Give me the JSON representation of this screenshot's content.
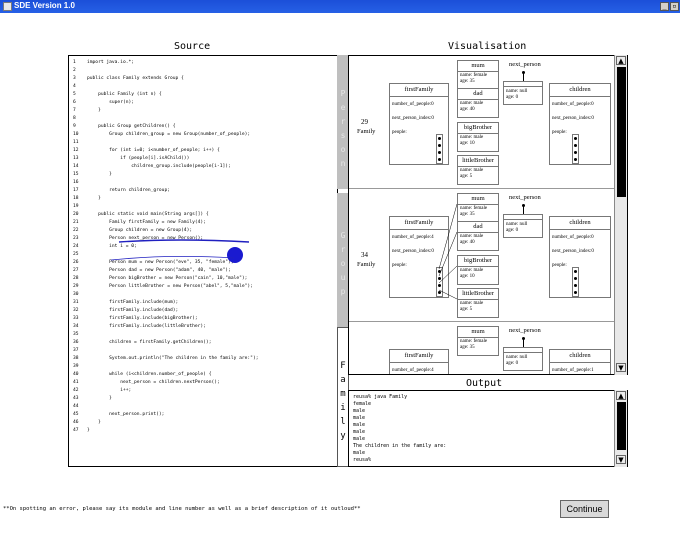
{
  "window": {
    "title": "SDE Version 1.0"
  },
  "source": {
    "header": "Source",
    "lines": [
      "import java.io.*;",
      "",
      "public class Family extends Group {",
      "",
      "    public Family (int n) {",
      "        super(n);",
      "    }",
      "",
      "    public Group getChildren() {",
      "        Group children_group = new Group(number_of_people);",
      "",
      "        for (int i=0; i<number_of_people; i++) {",
      "            if (people[i].isAChild())",
      "                children_group.include(people[i-1]);",
      "        }",
      "",
      "        return children_group;",
      "    }",
      "",
      "    public static void main(String args[]) {",
      "        Family firstFamily = new Family(4);",
      "        Group children = new Group(4);",
      "        Person next_person = new Person();",
      "        int i = 0;",
      "",
      "        Person mum = new Person(\"eve\", 35, \"female\");",
      "        Person dad = new Person(\"adam\", 40, \"male\");",
      "        Person bigBrother = new Person(\"cain\", 10,\"male\");",
      "        Person littleBrother = new Person(\"abel\", 5,\"male\");",
      "",
      "        firstFamily.include(mum);",
      "        firstFamily.include(dad);",
      "        firstFamily.include(bigBrother);",
      "        firstFamily.include(littleBrother);",
      "",
      "        children = firstFamily.getChildren();",
      "",
      "        System.out.println(\"The children in the family are:\");",
      "",
      "        while (i<children.number_of_people) {",
      "            next_person = children.nextPerson();",
      "            i++;",
      "        }",
      "",
      "        next_person.print();",
      "    }",
      "}"
    ]
  },
  "side_tabs": {
    "person": [
      "P",
      "e",
      "r",
      "s",
      "o",
      "n"
    ],
    "group": [
      "G",
      "r",
      "o",
      "u",
      "p"
    ],
    "family": [
      "F",
      "a",
      "m",
      "i",
      "l",
      "y"
    ]
  },
  "visualisation": {
    "header": "Visualisation",
    "frames": [
      {
        "count": "29",
        "label": "Family",
        "box_title": "firstFamily",
        "nop": "number_of_people:0",
        "npi": "next_person_index:0",
        "people": "people:",
        "children_title": "children",
        "c_nop": "number_of_people:0",
        "c_npi": "next_person_index:0",
        "c_people": "people:",
        "np_title": "next_person",
        "np_name": "name: null",
        "np_age": "age: 0",
        "mum": {
          "title": "mum",
          "name": "name: female",
          "age": "age: 35"
        },
        "dad": {
          "title": "dad",
          "name": "name: male",
          "age": "age: 40"
        },
        "big": {
          "title": "bigBrother",
          "name": "name: male",
          "age": "age: 10"
        },
        "little": {
          "title": "littleBrother",
          "name": "name: male",
          "age": "age: 5"
        }
      },
      {
        "count": "34",
        "label": "Family",
        "box_title": "firstFamily",
        "nop": "number_of_people:4",
        "npi": "next_person_index:0",
        "people": "people:",
        "children_title": "children",
        "c_nop": "number_of_people:0",
        "c_npi": "next_person_index:0",
        "c_people": "people:",
        "np_title": "next_person",
        "np_name": "name: null",
        "np_age": "age: 0",
        "mum": {
          "title": "mum",
          "name": "name: female",
          "age": "age: 35"
        },
        "dad": {
          "title": "dad",
          "name": "name: male",
          "age": "age: 40"
        },
        "big": {
          "title": "bigBrother",
          "name": "name: male",
          "age": "age: 10"
        },
        "little": {
          "title": "littleBrother",
          "name": "name: male",
          "age": "age: 5"
        }
      },
      {
        "box_title": "firstFamily",
        "nop": "number_of_people:4",
        "children_title": "children",
        "c_nop": "number_of_people:1",
        "np_title": "next_person",
        "np_name": "name: null",
        "np_age": "age: 0",
        "mum": {
          "title": "mum",
          "name": "name: female",
          "age": "age: 35"
        }
      }
    ]
  },
  "output": {
    "header": "Output",
    "lines": [
      "reusa% java Family",
      "female",
      "male",
      "male",
      "male",
      "male",
      "male",
      "The children in the family are:",
      "male",
      "reusa%"
    ]
  },
  "bottom": {
    "note": "**On spotting an error, please say its module and line number as well as a brief description of it outloud**",
    "continue_label": "Continue"
  }
}
